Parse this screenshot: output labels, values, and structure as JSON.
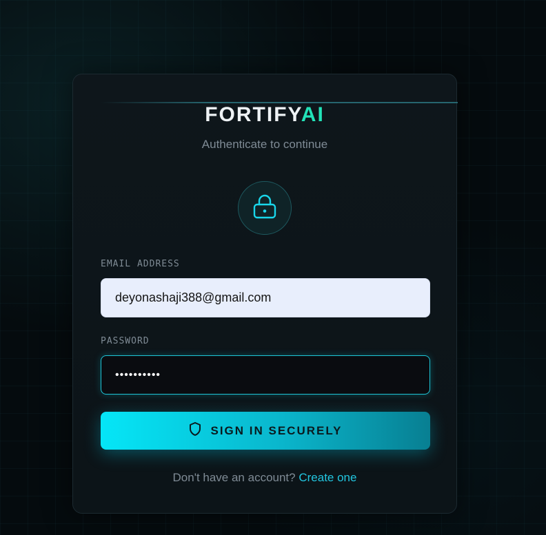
{
  "brand": {
    "name_main": "FORTIFY",
    "name_accent": "AI"
  },
  "subtitle": "Authenticate to continue",
  "lock_icon": "lock-icon",
  "form": {
    "email_label": "EMAIL ADDRESS",
    "email_value": "deyonashaji388@gmail.com",
    "password_label": "PASSWORD",
    "password_value": "••••••••••"
  },
  "signin": {
    "label": "SIGN IN SECURELY",
    "icon": "shield-icon"
  },
  "footer": {
    "prompt": "Don't have an account?",
    "link": "Create one"
  },
  "colors": {
    "accent_cyan": "#05e6f7",
    "accent_green": "#22e3b8",
    "link": "#22c6e0",
    "background": "#050b0e",
    "card": "#0e161b"
  }
}
